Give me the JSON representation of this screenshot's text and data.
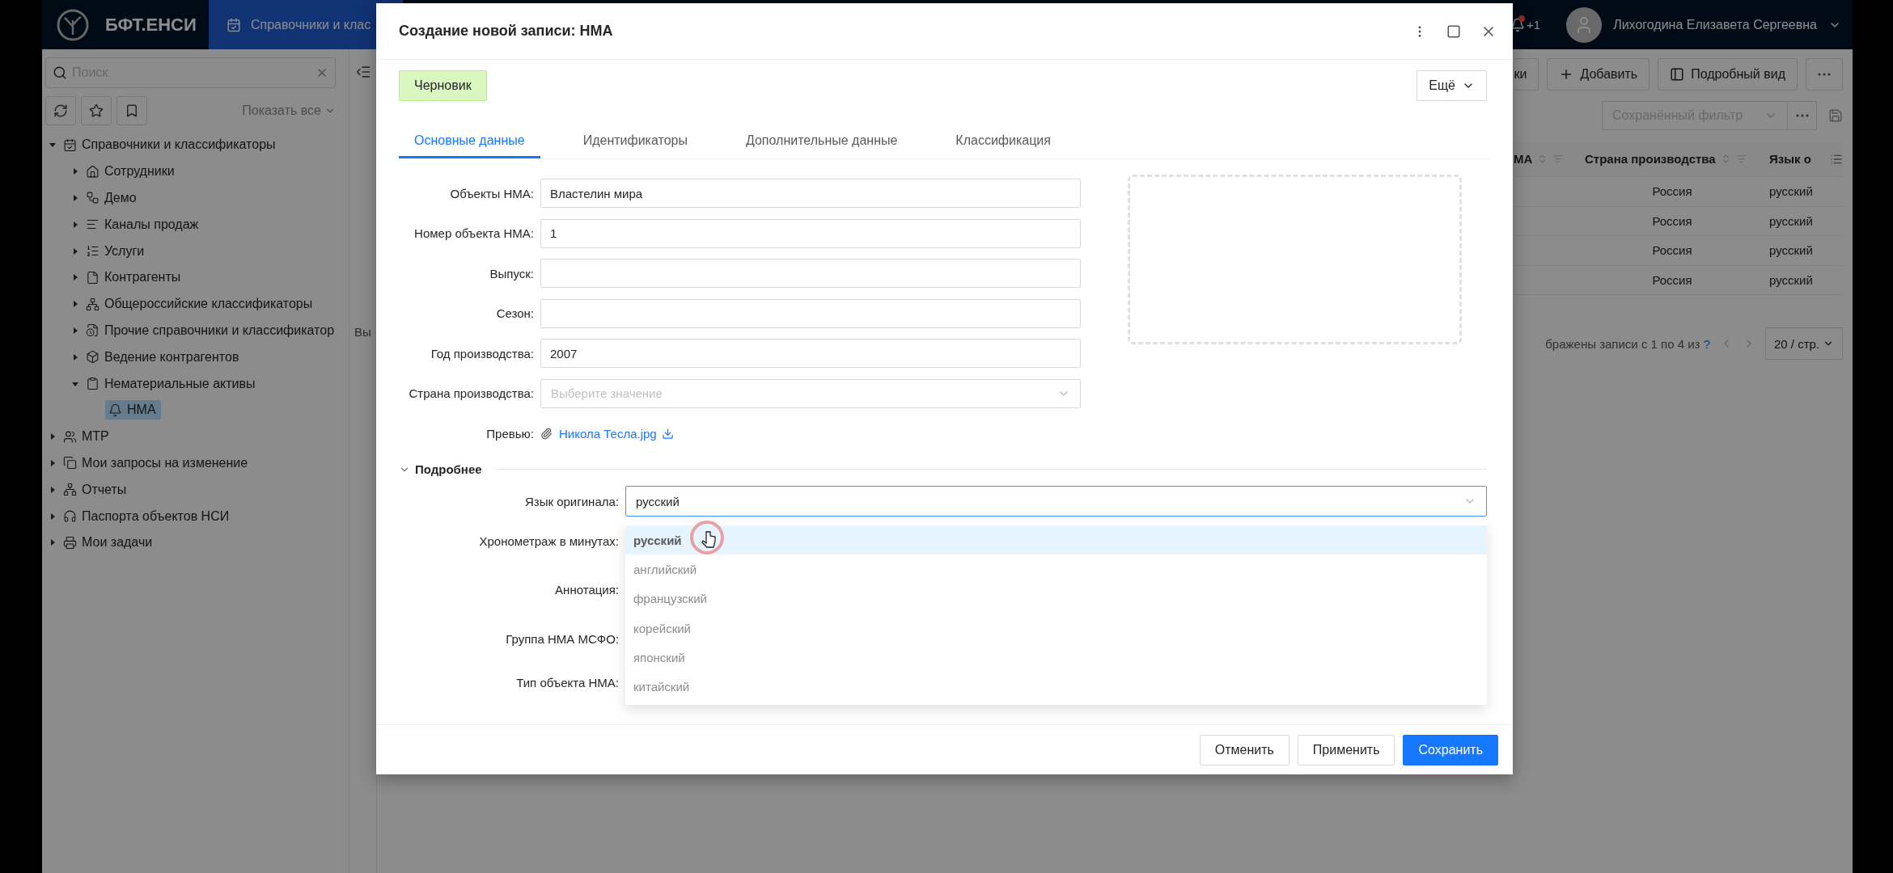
{
  "app": {
    "logo": "БФТ.ЕНСИ",
    "section_tab": "Справочники и клас"
  },
  "user_bar": {
    "notifications": "+1",
    "has_unread": true,
    "user": "Лихогодина Елизавета Сергеевна"
  },
  "sidebar": {
    "search_placeholder": "Поиск",
    "show_all": "Показать все",
    "tree": [
      {
        "label": "Справочники и классификаторы",
        "expanded": true,
        "selected": false,
        "children": [
          {
            "label": "Сотрудники",
            "expanded": false,
            "selected": false
          },
          {
            "label": "Демо",
            "expanded": false,
            "selected": false
          },
          {
            "label": "Каналы продаж",
            "expanded": false,
            "selected": false
          },
          {
            "label": "Услуги",
            "expanded": false,
            "selected": false
          },
          {
            "label": "Контрагенты",
            "expanded": false,
            "selected": false
          },
          {
            "label": "Общероссийские классификаторы",
            "expanded": false,
            "selected": false
          },
          {
            "label": "Прочие справочники и классификатор",
            "expanded": false,
            "selected": false
          },
          {
            "label": "Ведение контрагентов",
            "expanded": false,
            "selected": false
          },
          {
            "label": "Нематериальные активы",
            "expanded": true,
            "selected": false,
            "children": [
              {
                "label": "НМА",
                "selected": true
              }
            ]
          }
        ]
      },
      {
        "label": "МТР",
        "expanded": false,
        "selected": false
      },
      {
        "label": "Мои запросы на изменение",
        "expanded": false,
        "selected": false
      },
      {
        "label": "Отчеты",
        "expanded": false,
        "selected": false
      },
      {
        "label": "Паспорта объектов НСИ",
        "expanded": false,
        "selected": false
      },
      {
        "label": "Мои задачи",
        "expanded": false,
        "selected": false
      }
    ]
  },
  "gap_text": "Вы",
  "list_view": {
    "toolbar": [
      "ки",
      "Добавить",
      "Подробный вид"
    ],
    "saved_filter": "Сохранённый фильтр",
    "columns": [
      "МА",
      "Страна производства",
      "Язык о"
    ],
    "rows": [
      [
        "",
        "Россия",
        "русский"
      ],
      [
        "",
        "Россия",
        "русский"
      ],
      [
        "",
        "Россия",
        "русский"
      ],
      [
        "",
        "Россия",
        "русский"
      ]
    ],
    "pagination": "бражены записи с 1 по 4 из",
    "help": "?",
    "page_size": "20 / стр."
  },
  "dialog": {
    "title": "Создание новой записи: НМА",
    "status": "Черновик",
    "more": "Ещё",
    "tabs": [
      {
        "label": "Основные данные",
        "selected": true
      },
      {
        "label": "Идентификаторы",
        "selected": false
      },
      {
        "label": "Дополнительные данные",
        "selected": false
      },
      {
        "label": "Классификация",
        "selected": false
      }
    ],
    "fields": [
      {
        "label": "Объекты НМА:",
        "kind": "text",
        "value": "Властелин мира"
      },
      {
        "label": "Номер объекта НМА:",
        "kind": "text",
        "value": "1"
      },
      {
        "label": "Выпуск:",
        "kind": "text"
      },
      {
        "label": "Сезон:",
        "kind": "text"
      },
      {
        "label": "Год производства:",
        "kind": "text",
        "value": "2007"
      },
      {
        "label": "Страна производства:",
        "kind": "select",
        "placeholder": "Выберите значение"
      }
    ],
    "preview": {
      "label": "Превью:",
      "file": "Никола Тесла.jpg"
    },
    "section": {
      "title": "Подробнее",
      "expanded": true
    },
    "language": {
      "label": "Язык оригинала:",
      "value": "русский",
      "open": true
    },
    "details": [
      "Хронометраж в минутах:",
      "Аннотация:",
      "Группа НМА МСФО:",
      "Тип объекта НМА:"
    ],
    "options": [
      {
        "label": "русский",
        "selected": true
      },
      {
        "label": "английский",
        "selected": false
      },
      {
        "label": "французский",
        "selected": false
      },
      {
        "label": "корейский",
        "selected": false
      },
      {
        "label": "японский",
        "selected": false
      },
      {
        "label": "китайский",
        "selected": false
      }
    ],
    "buttons": [
      {
        "label": "Отменить",
        "kind": "default"
      },
      {
        "label": "Применить",
        "kind": "default"
      },
      {
        "label": "Сохранить",
        "kind": "primary"
      }
    ]
  }
}
